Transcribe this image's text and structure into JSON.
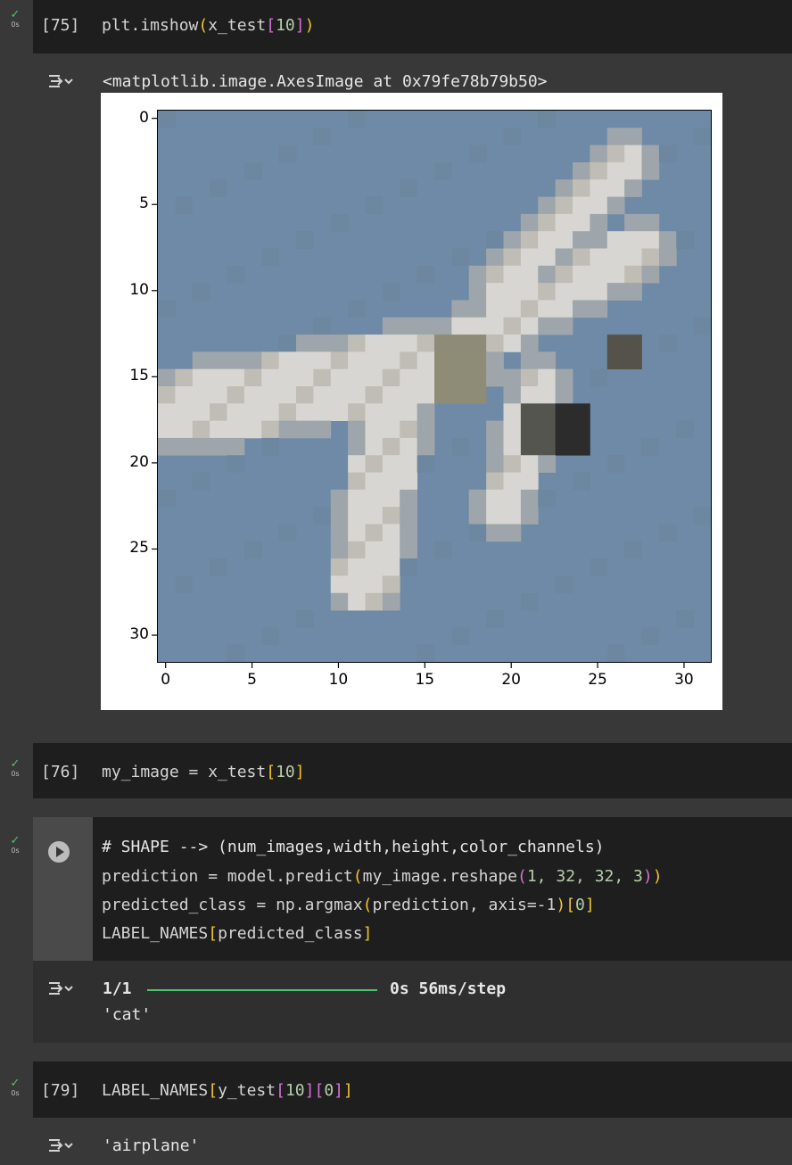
{
  "cells": {
    "cell75": {
      "exec": "[75]",
      "code_prefix": "plt.imshow",
      "code_paren_open": "(",
      "code_mid": "x_test",
      "code_bracket_open": "[",
      "code_index": "10",
      "code_bracket_close": "]",
      "code_paren_close": ")",
      "output_text": "<matplotlib.image.AxesImage at 0x79fe78b79b50>"
    },
    "cell76": {
      "exec": "[76]",
      "code_prefix": "my_image = x_test",
      "code_bracket_open": "[",
      "code_index": "10",
      "code_bracket_close": "]"
    },
    "cell77": {
      "line1": "# SHAPE --> (num_images,width,height,color_channels)",
      "line2_a": "prediction = model.predict",
      "line2_b": "(",
      "line2_c": "my_image.reshape",
      "line2_d": "(",
      "line2_e": "1, 32, 32, 3",
      "line2_f": ")",
      "line2_g": ")",
      "line3_a": "predicted_class = np.argmax",
      "line3_b": "(",
      "line3_c": "prediction, axis=-1",
      "line3_d": ")",
      "line3_e": "[",
      "line3_f": "0",
      "line3_g": "]",
      "line4_a": "LABEL_NAMES",
      "line4_b": "[",
      "line4_c": "predicted_class",
      "line4_d": "]",
      "output_progress": "1/1",
      "output_timing": "0s 56ms/step",
      "output_value": "'cat'"
    },
    "cell79": {
      "exec": "[79]",
      "code_prefix": "LABEL_NAMES",
      "code_b1": "[",
      "code_mid": "y_test",
      "code_b2": "[",
      "code_idx1": "10",
      "code_b3": "]",
      "code_b4": "[",
      "code_idx2": "0",
      "code_b5": "]",
      "code_b6": "]",
      "output_value": "'airplane'"
    }
  },
  "gutter": {
    "check": "✓",
    "time": "0s"
  },
  "chart_data": {
    "type": "heatmap",
    "description_kind": "image",
    "x_ticks": [
      "0",
      "5",
      "10",
      "15",
      "20",
      "25",
      "30"
    ],
    "y_ticks": [
      "0",
      "5",
      "10",
      "15",
      "20",
      "25",
      "30"
    ],
    "xlim": [
      -0.5,
      31.5
    ],
    "ylim": [
      31.5,
      -0.5
    ],
    "background_color": "#6f8aa6",
    "plane_light_color": "#d8d6d2",
    "plane_dark_color": "#2c2c2c"
  },
  "colors": {
    "accent_green": "#4ec36f",
    "bracket_yellow": "#f0c52c",
    "bracket_magenta": "#d670d6",
    "number_green": "#b5cea8"
  }
}
